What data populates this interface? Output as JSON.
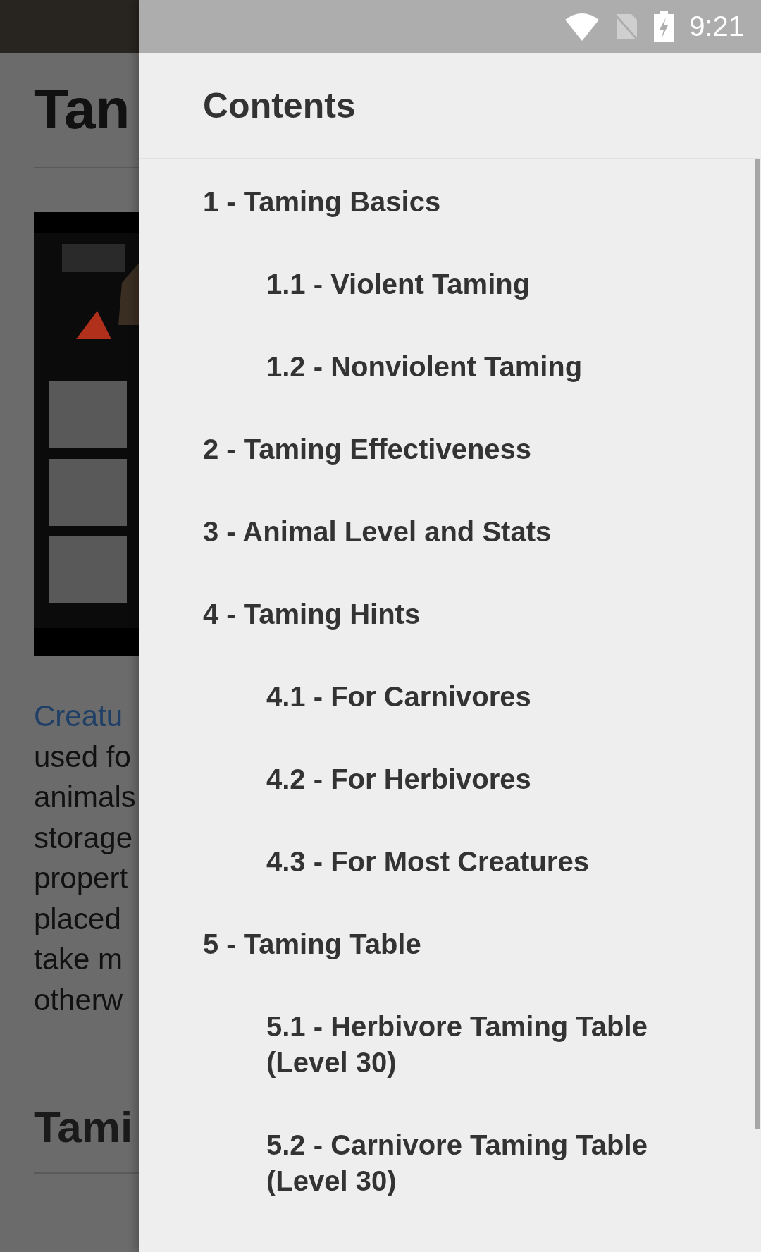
{
  "status_bar": {
    "time": "9:21"
  },
  "page": {
    "title": "Tan",
    "link": "Creatu",
    "lines": [
      "used fo",
      "animals",
      "storage",
      "propert",
      "placed",
      "take m",
      "otherw"
    ],
    "heading": "Tami"
  },
  "drawer": {
    "title": "Contents",
    "items": [
      {
        "label": "1 - Taming Basics",
        "children": [
          {
            "label": "1.1 - Violent Taming"
          },
          {
            "label": "1.2 - Nonviolent Taming"
          }
        ]
      },
      {
        "label": "2 - Taming Effectiveness"
      },
      {
        "label": "3 - Animal Level and Stats"
      },
      {
        "label": "4 - Taming Hints",
        "children": [
          {
            "label": "4.1 - For Carnivores"
          },
          {
            "label": "4.2 - For Herbivores"
          },
          {
            "label": "4.3 - For Most Creatures"
          }
        ]
      },
      {
        "label": "5 - Taming Table",
        "children": [
          {
            "label": "5.1 - Herbivore Taming Table (Level 30)"
          },
          {
            "label": "5.2 - Carnivore Taming Table (Level 30)"
          }
        ]
      }
    ]
  }
}
